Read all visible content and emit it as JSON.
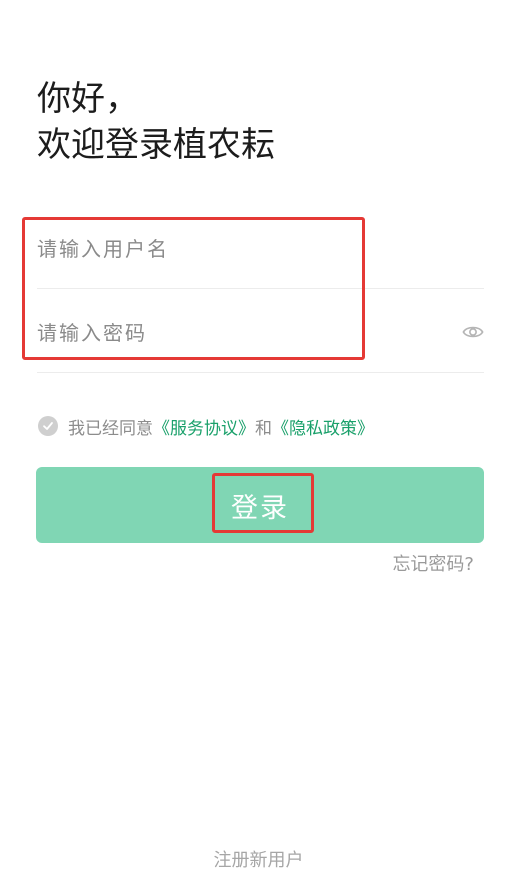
{
  "greeting": {
    "line1": "你好，",
    "line2": "欢迎登录植农耘"
  },
  "form": {
    "username_placeholder": "请输入用户名",
    "username_value": "",
    "password_placeholder": "请输入密码",
    "password_value": "",
    "password_visibility_icon": "eye-icon"
  },
  "agreement": {
    "prefix": "我已经同意",
    "terms_link": "《服务协议》",
    "and": "和",
    "privacy_link": "《隐私政策》",
    "checked": false
  },
  "login_button": "登录",
  "forgot_password": "忘记密码?",
  "register": "注册新用户",
  "colors": {
    "accent": "#19a06a",
    "button": "#80d6b4",
    "highlight": "#e53935"
  }
}
